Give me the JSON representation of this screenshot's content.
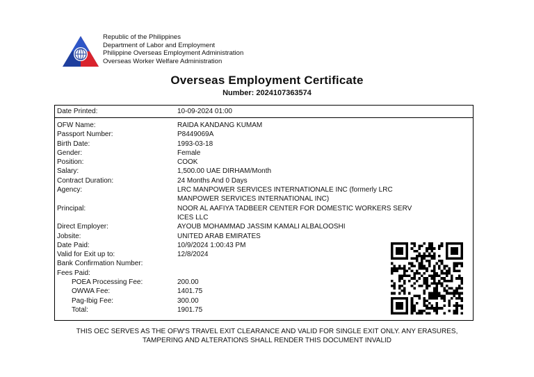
{
  "header": {
    "lines": [
      "Republic of the Philippines",
      "Department of Labor and Employment",
      "Philippine Overseas Employment Administration",
      "Overseas Worker Welfare Administration"
    ]
  },
  "title": "Overseas Employment Certificate",
  "number": "Number: 2024107363574",
  "date_printed": {
    "label": "Date Printed:",
    "value": "10-09-2024 01:00"
  },
  "fields": {
    "ofw_name": {
      "label": "OFW Name:",
      "value": "RAIDA KANDANG KUMAM"
    },
    "passport": {
      "label": "Passport Number:",
      "value": "P8449069A"
    },
    "birth_date": {
      "label": "Birth Date:",
      "value": "1993-03-18"
    },
    "gender": {
      "label": "Gender:",
      "value": "Female"
    },
    "position": {
      "label": "Position:",
      "value": "COOK"
    },
    "salary": {
      "label": "Salary:",
      "value": "1,500.00 UAE DIRHAM/Month"
    },
    "contract": {
      "label": "Contract Duration:",
      "value": "24 Months And 0 Days"
    },
    "agency": {
      "label": "Agency:",
      "value": "LRC MANPOWER SERVICES INTERNATIONALE INC (formerly  LRC",
      "value2": " MANPOWER SERVICES INTERNATIONAL INC)"
    },
    "principal": {
      "label": "Principal:",
      "value": "NOOR AL AAFIYA TADBEER CENTER FOR DOMESTIC WORKERS SERV",
      "value2": "ICES LLC"
    },
    "direct_employer": {
      "label": "Direct Employer:",
      "value": " AYOUB MOHAMMAD JASSIM KAMALI ALBALOOSHI"
    },
    "jobsite": {
      "label": "Jobsite:",
      "value": "UNITED ARAB EMIRATES"
    },
    "date_paid": {
      "label": "Date Paid:",
      "value": "10/9/2024 1:00:43 PM"
    },
    "valid_exit": {
      "label": "Valid for Exit up to:",
      "value": "12/8/2024"
    },
    "bank_conf": {
      "label": "Bank Confirmation Number:",
      "value": ""
    },
    "fees_paid": {
      "label": "Fees Paid:"
    },
    "poea_fee": {
      "label": "POEA Processing Fee:",
      "value": "200.00"
    },
    "owwa_fee": {
      "label": "OWWA Fee:",
      "value": "1401.75"
    },
    "pagibig_fee": {
      "label": "Pag-Ibig Fee:",
      "value": "300.00"
    },
    "total": {
      "label": "Total:",
      "value": "1901.75"
    }
  },
  "footer": {
    "line1": "THIS OEC SERVES AS THE OFW'S TRAVEL EXIT CLEARANCE AND VALID FOR SINGLE EXIT ONLY. ANY ERASURES,",
    "line2": "TAMPERING AND ALTERATIONS SHALL RENDER THIS DOCUMENT INVALID"
  },
  "colors": {
    "logo_blue": "#1f3f9e",
    "logo_red": "#d9232d",
    "text": "#111111"
  }
}
